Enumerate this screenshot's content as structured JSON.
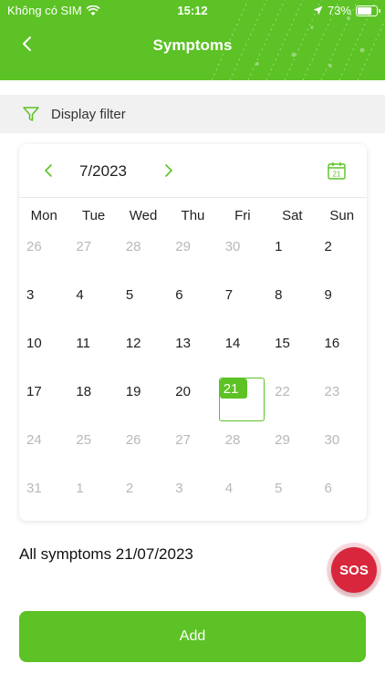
{
  "status_bar": {
    "carrier": "Không có SIM",
    "time": "15:12",
    "battery": "73%"
  },
  "header": {
    "title": "Symptoms"
  },
  "filter": {
    "label": "Display filter"
  },
  "calendar": {
    "month_label": "7/2023",
    "weekdays": [
      "Mon",
      "Tue",
      "Wed",
      "Thu",
      "Fri",
      "Sat",
      "Sun"
    ],
    "weeks": [
      [
        {
          "d": "26",
          "muted": true
        },
        {
          "d": "27",
          "muted": true
        },
        {
          "d": "28",
          "muted": true
        },
        {
          "d": "29",
          "muted": true
        },
        {
          "d": "30",
          "muted": true
        },
        {
          "d": "1",
          "muted": false
        },
        {
          "d": "2",
          "muted": false
        }
      ],
      [
        {
          "d": "3",
          "muted": false
        },
        {
          "d": "4",
          "muted": false
        },
        {
          "d": "5",
          "muted": false
        },
        {
          "d": "6",
          "muted": false
        },
        {
          "d": "7",
          "muted": false
        },
        {
          "d": "8",
          "muted": false
        },
        {
          "d": "9",
          "muted": false
        }
      ],
      [
        {
          "d": "10",
          "muted": false
        },
        {
          "d": "11",
          "muted": false
        },
        {
          "d": "12",
          "muted": false
        },
        {
          "d": "13",
          "muted": false
        },
        {
          "d": "14",
          "muted": false
        },
        {
          "d": "15",
          "muted": false
        },
        {
          "d": "16",
          "muted": false
        }
      ],
      [
        {
          "d": "17",
          "muted": false
        },
        {
          "d": "18",
          "muted": false
        },
        {
          "d": "19",
          "muted": false
        },
        {
          "d": "20",
          "muted": false
        },
        {
          "d": "21",
          "muted": false,
          "selected": true
        },
        {
          "d": "22",
          "muted": true
        },
        {
          "d": "23",
          "muted": true
        }
      ],
      [
        {
          "d": "24",
          "muted": true
        },
        {
          "d": "25",
          "muted": true
        },
        {
          "d": "26",
          "muted": true
        },
        {
          "d": "27",
          "muted": true
        },
        {
          "d": "28",
          "muted": true
        },
        {
          "d": "29",
          "muted": true
        },
        {
          "d": "30",
          "muted": true
        }
      ],
      [
        {
          "d": "31",
          "muted": true
        },
        {
          "d": "1",
          "muted": true
        },
        {
          "d": "2",
          "muted": true
        },
        {
          "d": "3",
          "muted": true
        },
        {
          "d": "4",
          "muted": true
        },
        {
          "d": "5",
          "muted": true
        },
        {
          "d": "6",
          "muted": true
        }
      ]
    ],
    "calendar_icon_day": "21"
  },
  "summary": {
    "text": "All symptoms 21/07/2023"
  },
  "sos": {
    "label": "SOS"
  },
  "add_button": {
    "label": "Add"
  },
  "icons": {
    "back": "chevron-left-icon",
    "filter": "funnel-icon",
    "prev": "chevron-left-icon",
    "next": "chevron-right-icon",
    "calendar": "calendar-icon",
    "wifi": "wifi-icon",
    "location": "location-arrow-icon",
    "battery": "battery-icon"
  },
  "colors": {
    "accent": "#5cc225",
    "sos": "#d8263c",
    "muted_text": "#b8b8b8",
    "filter_bg": "#f1f1f1"
  }
}
